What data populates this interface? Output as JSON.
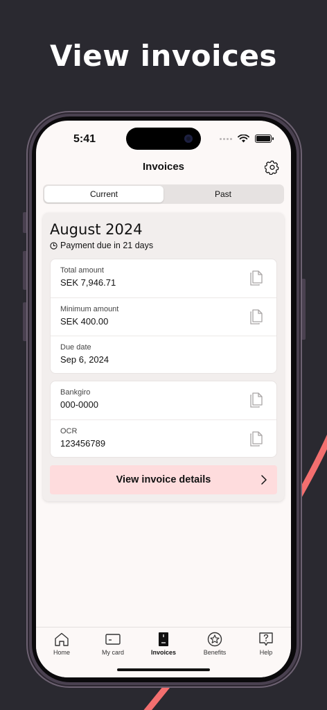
{
  "headline": "View invoices",
  "status": {
    "time": "5:41"
  },
  "header": {
    "title": "Invoices"
  },
  "tabs": [
    {
      "label": "Current",
      "active": true
    },
    {
      "label": "Past",
      "active": false
    }
  ],
  "invoice": {
    "title": "August 2024",
    "due_text": "Payment due in 21 days",
    "amounts": [
      {
        "label": "Total amount",
        "value": "SEK 7,946.71",
        "copyable": true
      },
      {
        "label": "Minimum amount",
        "value": "SEK 400.00",
        "copyable": true
      },
      {
        "label": "Due date",
        "value": "Sep 6, 2024",
        "copyable": false
      }
    ],
    "payment": [
      {
        "label": "Bankgiro",
        "value": "000-0000",
        "copyable": true
      },
      {
        "label": "OCR",
        "value": "123456789",
        "copyable": true
      }
    ],
    "details_button": "View invoice details"
  },
  "tabbar": [
    {
      "label": "Home",
      "icon": "home-icon",
      "active": false
    },
    {
      "label": "My card",
      "icon": "card-icon",
      "active": false
    },
    {
      "label": "Invoices",
      "icon": "invoice-icon",
      "active": true
    },
    {
      "label": "Benefits",
      "icon": "star-badge-icon",
      "active": false
    },
    {
      "label": "Help",
      "icon": "help-icon",
      "active": false
    }
  ],
  "colors": {
    "background": "#2a2930",
    "accent_arc": "#f36f6f",
    "details_button_bg": "#fedcdd",
    "screen_bg": "#fcf8f7"
  }
}
